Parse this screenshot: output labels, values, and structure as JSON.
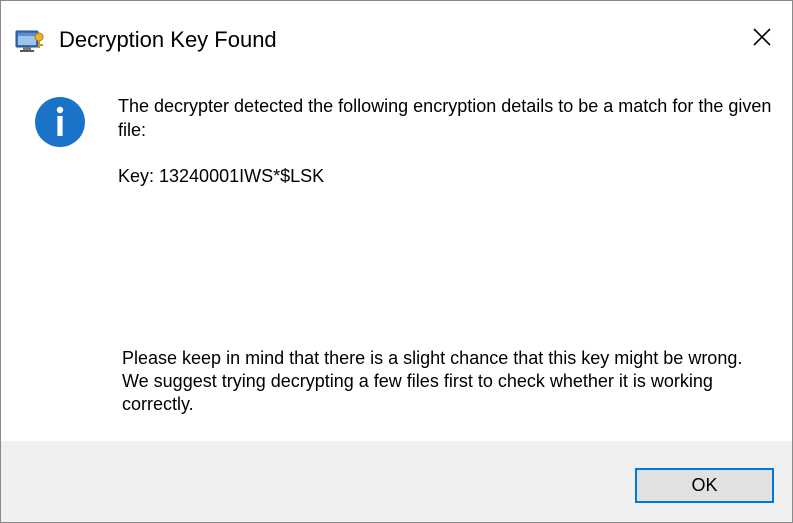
{
  "dialog": {
    "title": "Decryption Key Found",
    "message": "The decrypter detected the following encryption details to be a match for the given file:",
    "key_line": "Key: 13240001IWS*$LSK",
    "note": "Please keep in mind that there is a slight chance that this key might be wrong. We suggest trying decrypting a few files first to check whether it is working correctly.",
    "ok_label": "OK"
  },
  "icons": {
    "app": "app-window-icon",
    "info": "info-icon",
    "close": "close-icon"
  },
  "colors": {
    "accent": "#0078d7",
    "info_icon": "#1a73c8",
    "footer_bg": "#f0f0f0",
    "button_bg": "#e1e1e1"
  }
}
